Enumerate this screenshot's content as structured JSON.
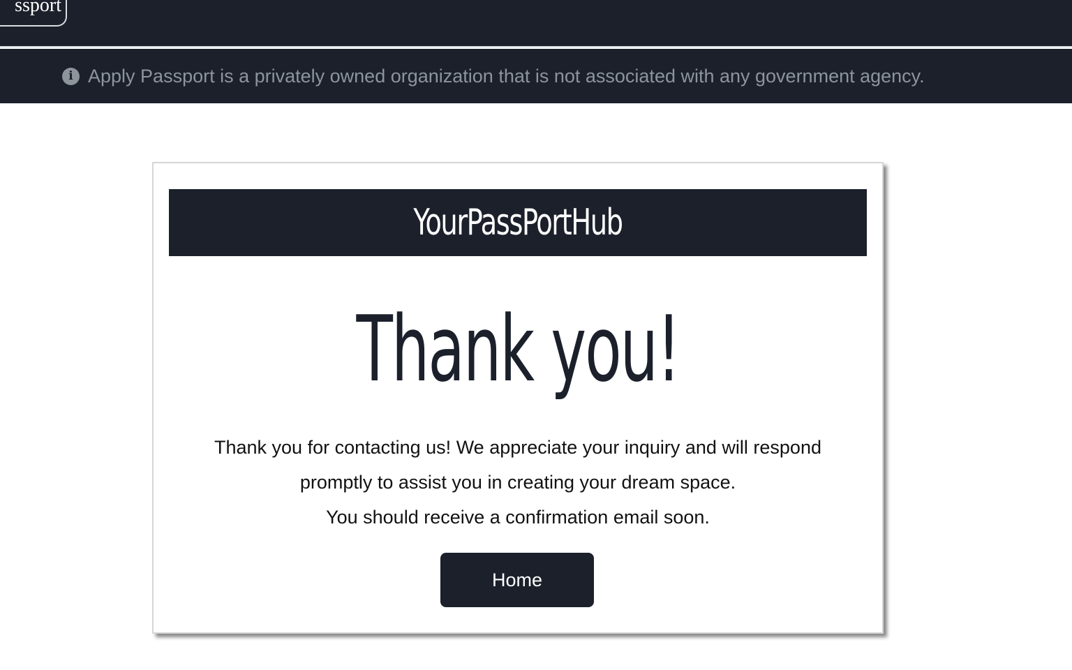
{
  "header": {
    "logo_text": "ssport"
  },
  "notice": {
    "icon": "info-icon",
    "icon_glyph": "i",
    "text": "Apply Passport is a privately owned organization that is not associated with any government agency."
  },
  "card": {
    "brand": "YourPassPortHub",
    "title": "Thank you!",
    "message_line1": "Thank you for contacting us! We appreciate your inquiry and will respond",
    "message_line2": "promptly to assist you in creating your dream space.",
    "message_line3": "You should receive a confirmation email soon.",
    "home_button": "Home"
  },
  "colors": {
    "dark": "#1b202b",
    "muted_text": "#8e949c",
    "background": "#ffffff"
  }
}
